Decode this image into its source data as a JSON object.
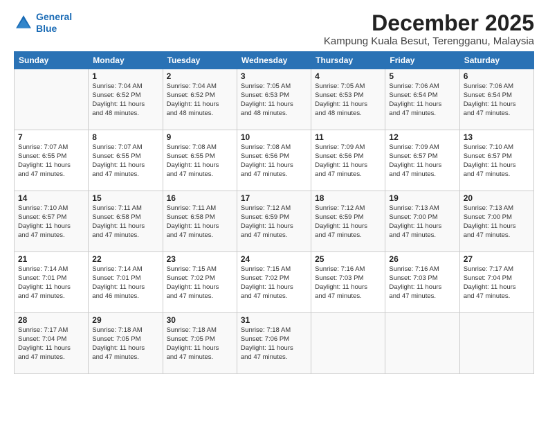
{
  "logo": {
    "line1": "General",
    "line2": "Blue"
  },
  "title": "December 2025",
  "location": "Kampung Kuala Besut, Terengganu, Malaysia",
  "days_header": [
    "Sunday",
    "Monday",
    "Tuesday",
    "Wednesday",
    "Thursday",
    "Friday",
    "Saturday"
  ],
  "weeks": [
    [
      {
        "day": "",
        "info": ""
      },
      {
        "day": "1",
        "info": "Sunrise: 7:04 AM\nSunset: 6:52 PM\nDaylight: 11 hours\nand 48 minutes."
      },
      {
        "day": "2",
        "info": "Sunrise: 7:04 AM\nSunset: 6:52 PM\nDaylight: 11 hours\nand 48 minutes."
      },
      {
        "day": "3",
        "info": "Sunrise: 7:05 AM\nSunset: 6:53 PM\nDaylight: 11 hours\nand 48 minutes."
      },
      {
        "day": "4",
        "info": "Sunrise: 7:05 AM\nSunset: 6:53 PM\nDaylight: 11 hours\nand 48 minutes."
      },
      {
        "day": "5",
        "info": "Sunrise: 7:06 AM\nSunset: 6:54 PM\nDaylight: 11 hours\nand 47 minutes."
      },
      {
        "day": "6",
        "info": "Sunrise: 7:06 AM\nSunset: 6:54 PM\nDaylight: 11 hours\nand 47 minutes."
      }
    ],
    [
      {
        "day": "7",
        "info": "Sunrise: 7:07 AM\nSunset: 6:55 PM\nDaylight: 11 hours\nand 47 minutes."
      },
      {
        "day": "8",
        "info": "Sunrise: 7:07 AM\nSunset: 6:55 PM\nDaylight: 11 hours\nand 47 minutes."
      },
      {
        "day": "9",
        "info": "Sunrise: 7:08 AM\nSunset: 6:55 PM\nDaylight: 11 hours\nand 47 minutes."
      },
      {
        "day": "10",
        "info": "Sunrise: 7:08 AM\nSunset: 6:56 PM\nDaylight: 11 hours\nand 47 minutes."
      },
      {
        "day": "11",
        "info": "Sunrise: 7:09 AM\nSunset: 6:56 PM\nDaylight: 11 hours\nand 47 minutes."
      },
      {
        "day": "12",
        "info": "Sunrise: 7:09 AM\nSunset: 6:57 PM\nDaylight: 11 hours\nand 47 minutes."
      },
      {
        "day": "13",
        "info": "Sunrise: 7:10 AM\nSunset: 6:57 PM\nDaylight: 11 hours\nand 47 minutes."
      }
    ],
    [
      {
        "day": "14",
        "info": "Sunrise: 7:10 AM\nSunset: 6:57 PM\nDaylight: 11 hours\nand 47 minutes."
      },
      {
        "day": "15",
        "info": "Sunrise: 7:11 AM\nSunset: 6:58 PM\nDaylight: 11 hours\nand 47 minutes."
      },
      {
        "day": "16",
        "info": "Sunrise: 7:11 AM\nSunset: 6:58 PM\nDaylight: 11 hours\nand 47 minutes."
      },
      {
        "day": "17",
        "info": "Sunrise: 7:12 AM\nSunset: 6:59 PM\nDaylight: 11 hours\nand 47 minutes."
      },
      {
        "day": "18",
        "info": "Sunrise: 7:12 AM\nSunset: 6:59 PM\nDaylight: 11 hours\nand 47 minutes."
      },
      {
        "day": "19",
        "info": "Sunrise: 7:13 AM\nSunset: 7:00 PM\nDaylight: 11 hours\nand 47 minutes."
      },
      {
        "day": "20",
        "info": "Sunrise: 7:13 AM\nSunset: 7:00 PM\nDaylight: 11 hours\nand 47 minutes."
      }
    ],
    [
      {
        "day": "21",
        "info": "Sunrise: 7:14 AM\nSunset: 7:01 PM\nDaylight: 11 hours\nand 47 minutes."
      },
      {
        "day": "22",
        "info": "Sunrise: 7:14 AM\nSunset: 7:01 PM\nDaylight: 11 hours\nand 46 minutes."
      },
      {
        "day": "23",
        "info": "Sunrise: 7:15 AM\nSunset: 7:02 PM\nDaylight: 11 hours\nand 47 minutes."
      },
      {
        "day": "24",
        "info": "Sunrise: 7:15 AM\nSunset: 7:02 PM\nDaylight: 11 hours\nand 47 minutes."
      },
      {
        "day": "25",
        "info": "Sunrise: 7:16 AM\nSunset: 7:03 PM\nDaylight: 11 hours\nand 47 minutes."
      },
      {
        "day": "26",
        "info": "Sunrise: 7:16 AM\nSunset: 7:03 PM\nDaylight: 11 hours\nand 47 minutes."
      },
      {
        "day": "27",
        "info": "Sunrise: 7:17 AM\nSunset: 7:04 PM\nDaylight: 11 hours\nand 47 minutes."
      }
    ],
    [
      {
        "day": "28",
        "info": "Sunrise: 7:17 AM\nSunset: 7:04 PM\nDaylight: 11 hours\nand 47 minutes."
      },
      {
        "day": "29",
        "info": "Sunrise: 7:18 AM\nSunset: 7:05 PM\nDaylight: 11 hours\nand 47 minutes."
      },
      {
        "day": "30",
        "info": "Sunrise: 7:18 AM\nSunset: 7:05 PM\nDaylight: 11 hours\nand 47 minutes."
      },
      {
        "day": "31",
        "info": "Sunrise: 7:18 AM\nSunset: 7:06 PM\nDaylight: 11 hours\nand 47 minutes."
      },
      {
        "day": "",
        "info": ""
      },
      {
        "day": "",
        "info": ""
      },
      {
        "day": "",
        "info": ""
      }
    ]
  ]
}
